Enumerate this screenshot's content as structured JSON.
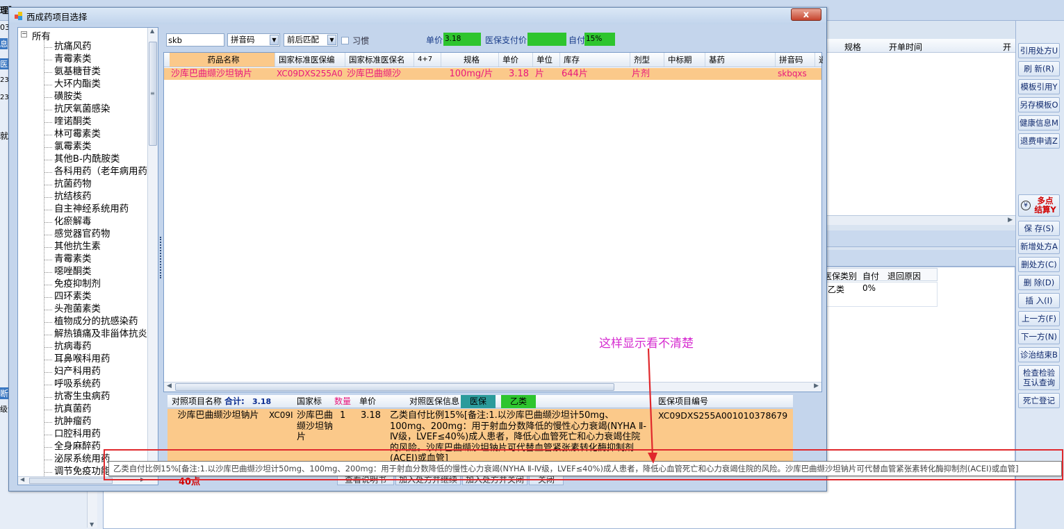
{
  "background": {
    "list_headers": [
      "规格",
      "开单时间",
      "开"
    ],
    "right_buttons": [
      "引用处方U",
      "刷 新(R)",
      "模板引用Y",
      "另存模板O",
      "健康信息M",
      "退费申请Z"
    ],
    "multipoint_button": "多点结算Y",
    "right_buttons_lower": [
      "保 存(S)",
      "新增处方A",
      "删处方(C)",
      "删 除(D)",
      "插 入(I)",
      "上一方(F)",
      "下一方(N)",
      "诊治结束B",
      "检查检验互认查询",
      "死亡登记"
    ],
    "sub_table": {
      "headers": [
        "医保类别",
        "自付",
        "退回原因"
      ],
      "row": [
        "乙类",
        "0%",
        ""
      ]
    },
    "left_fragments": [
      "理】",
      "03",
      "息",
      "医生",
      "23",
      "23",
      "就诊",
      "断",
      "级诊"
    ]
  },
  "window": {
    "title": "西成药项目选择",
    "close_label": "x"
  },
  "tree": {
    "root": "所有",
    "items": [
      "抗痛风药",
      "青霉素类",
      "氨基糖苷类",
      "大环内酯类",
      "磺胺类",
      "抗厌氧菌感染",
      "喹诺酮类",
      "林可霉素类",
      "氯霉素类",
      "其他B-内酰胺类",
      "各科用药（老年病用药",
      "抗菌药物",
      "抗结核药",
      "自主神经系统用药",
      "化瘀解毒",
      "感觉器官药物",
      "其他抗生素",
      "青霉素类",
      "噁唑酮类",
      "免疫抑制剂",
      "四环素类",
      "头孢菌素类",
      "植物成分的抗感染药",
      "解热镇痛及非甾体抗炎",
      "抗病毒药",
      "耳鼻喉科用药",
      "妇产科用药",
      "呼吸系统药",
      "抗寄生虫病药",
      "抗真菌药",
      "抗肿瘤药",
      "口腔科用药",
      "全身麻醉药",
      "泌尿系统用药",
      "调节免疫功能"
    ]
  },
  "search": {
    "value": "skb",
    "type": "拼音码",
    "match": "前后匹配",
    "habit_label": "习惯",
    "price_label": "单价",
    "price_value": "3.18",
    "insurance_label": "医保支付价",
    "insurance_value": "",
    "selfpay_label": "自付",
    "selfpay_value": "15%"
  },
  "drug_table": {
    "headers": [
      "药品名称",
      "国家标准医保编",
      "国家标准医保名",
      "4+7",
      "规格",
      "单价",
      "单位",
      "库存",
      "剂型",
      "中标期",
      "基药",
      "拼音码",
      "通"
    ],
    "rows": [
      [
        "沙库巴曲缬沙坦钠片",
        "XC09DXS255A0",
        "沙库巴曲缬沙",
        "",
        "100mg/片",
        "3.18",
        "片",
        "644片",
        "片剂",
        "",
        "",
        "skbqxs",
        ""
      ]
    ]
  },
  "bottom_table": {
    "headers": {
      "name": "对照项目名称",
      "total_label": "合计:",
      "total_value": "3.18",
      "national": "国家标",
      "qty": "数量",
      "price": "单价",
      "info": "对照医保信息",
      "tag_yb": "医保",
      "tag_yl": "乙类",
      "code": "医保项目编号"
    },
    "row": {
      "name": "沙库巴曲缬沙坦钠片",
      "code_short": "XC09I",
      "national_name": "沙库巴曲缬沙坦钠片",
      "qty": "1",
      "price": "3.18",
      "info": "乙类自付比例15%[备注:1.以沙库巴曲缬沙坦计50mg、100mg、200mg：用于射血分数降低的慢性心力衰竭(NYHA Ⅱ-Ⅳ级，LVEF≤40%)成人患者，降低心血管死亡和心力衰竭住院的风险。沙库巴曲缬沙坦钠片可代替血管紧张素转化酶抑制剂(ACEI)或血管]",
      "insurance_code": "XC09DXS255A001010378679"
    }
  },
  "buttons_row": [
    "查看说明书",
    "加入处方并继续",
    "加入处方并关闭",
    "关闭"
  ],
  "bottom_left_text": "40点",
  "tooltip": "乙类自付比例15%[备注:1.以沙库巴曲缬沙坦计50mg、100mg、200mg：用于射血分数降低的慢性心力衰竭(NYHA Ⅱ-Ⅳ级，LVEF≤40%)成人患者，降低心血管死亡和心力衰竭住院的风险。沙库巴曲缬沙坦钠片可代替血管紧张素转化酶抑制剂(ACEI)或血管]",
  "annotation": "这样显示看不清楚",
  "colors": {
    "accent_pink": "#e8177c",
    "row_orange": "#fbc98a",
    "green": "#2ec52e",
    "teal": "#2b9b9b",
    "red_box": "#e0282c"
  }
}
